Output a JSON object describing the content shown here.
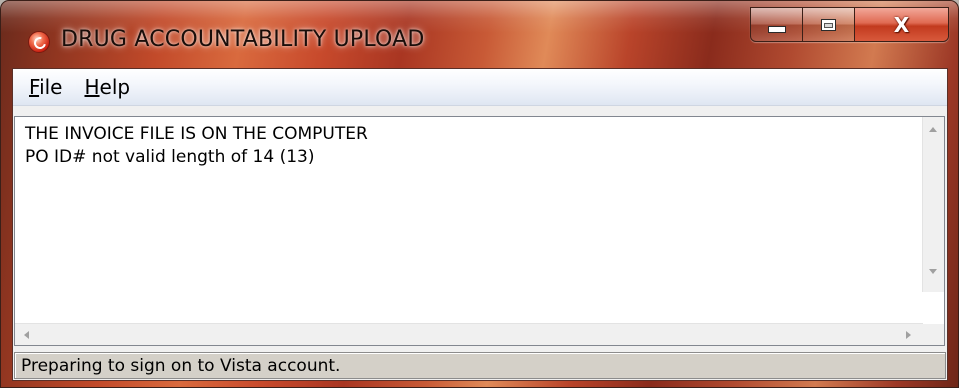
{
  "window": {
    "title": "DRUG ACCOUNTABILITY UPLOAD",
    "app_icon": "red-circular-app-icon",
    "caption_buttons": {
      "minimize_icon": "minimize-icon",
      "maximize_icon": "maximize-icon",
      "close_label": "X"
    }
  },
  "menu": {
    "items": [
      {
        "label_first": "F",
        "label_rest": "ile"
      },
      {
        "label_first": "H",
        "label_rest": "elp"
      }
    ]
  },
  "log": {
    "text": "THE INVOICE FILE IS ON THE COMPUTER\nPO ID# not valid length of 14 (13)"
  },
  "status": {
    "text": "Preparing to sign on to Vista account."
  },
  "colors": {
    "title_bar_theme": "#c24a2a",
    "close_button": "#c23a1e",
    "client_background": "#f0f0f0",
    "status_bar": "#d4d0c8"
  }
}
